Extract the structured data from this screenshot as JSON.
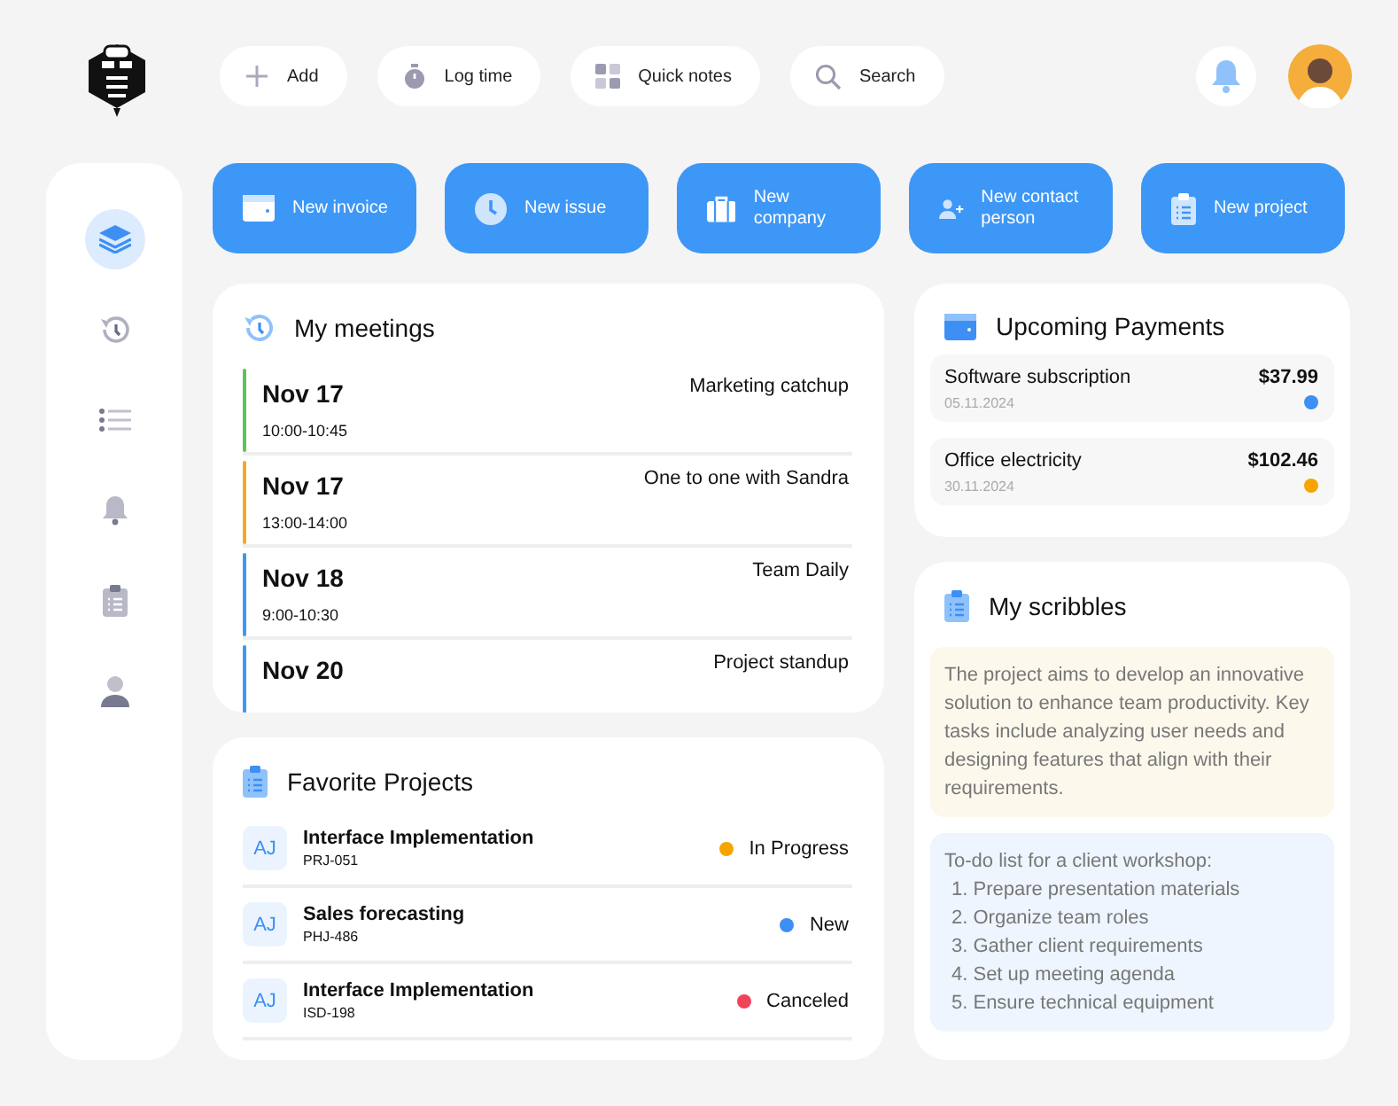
{
  "topbar": {
    "pills": [
      {
        "kind": "plus",
        "label": "Add"
      },
      {
        "kind": "stopwatch",
        "label": "Log time"
      },
      {
        "kind": "grid",
        "label": "Quick notes"
      },
      {
        "kind": "search",
        "label": "Search"
      }
    ]
  },
  "sidebar": {
    "items": [
      {
        "kind": "layers",
        "selected": true
      },
      {
        "kind": "history",
        "selected": false
      },
      {
        "kind": "list",
        "selected": false
      },
      {
        "kind": "bell",
        "selected": false
      },
      {
        "kind": "clipboard",
        "selected": false
      },
      {
        "kind": "person",
        "selected": false
      }
    ]
  },
  "actions": [
    {
      "kind": "wallet",
      "label": "New invoice"
    },
    {
      "kind": "clock",
      "label": "New issue"
    },
    {
      "kind": "briefcase",
      "label": "New company"
    },
    {
      "kind": "person-add",
      "label": "New contact person"
    },
    {
      "kind": "clipboard",
      "label": "New project"
    }
  ],
  "meetings": {
    "title": "My meetings",
    "items": [
      {
        "date": "Nov 17",
        "time": "10:00-10:45",
        "title": "Marketing catchup",
        "color": "#5cc35a"
      },
      {
        "date": "Nov 17",
        "time": "13:00-14:00",
        "title": "One to one with Sandra",
        "color": "#f7a823"
      },
      {
        "date": "Nov 18",
        "time": "9:00-10:30",
        "title": "Team Daily",
        "color": "#3d97f7"
      },
      {
        "date": "Nov 20",
        "title": "Project standup",
        "color": "#3d97f7"
      }
    ]
  },
  "projects": {
    "title": "Favorite Projects",
    "items": [
      {
        "initials": "AJ",
        "name": "Interface Implementation",
        "code": "PRJ-051",
        "status": "In Progress",
        "color": "#f7a400"
      },
      {
        "initials": "AJ",
        "name": "Sales forecasting",
        "code": "PHJ-486",
        "status": "New",
        "color": "#3d8ff5"
      },
      {
        "initials": "AJ",
        "name": "Interface Implementation",
        "code": "ISD-198",
        "status": "Canceled",
        "color": "#f0445a"
      }
    ]
  },
  "payments": {
    "title": "Upcoming Payments",
    "items": [
      {
        "name": "Software subscription",
        "date": "05.11.2024",
        "amount": "$37.99",
        "color": "#3d8ff5"
      },
      {
        "name": "Office electricity",
        "date": "30.11.2024",
        "amount": "$102.46",
        "color": "#f7a400"
      }
    ]
  },
  "scribbles": {
    "title": "My scribbles",
    "notes": [
      {
        "kind": "text",
        "text": "The project aims to develop an innovative solution to enhance team productivity. Key tasks include analyzing user needs and designing features that align with their requirements."
      },
      {
        "kind": "list",
        "text": "To-do list for a client workshop:",
        "items": [
          "1. Prepare presentation materials",
          "2. Organize team roles",
          "3. Gather client requirements",
          "4. Set up meeting agenda",
          "5. Ensure technical equipment"
        ]
      }
    ]
  }
}
